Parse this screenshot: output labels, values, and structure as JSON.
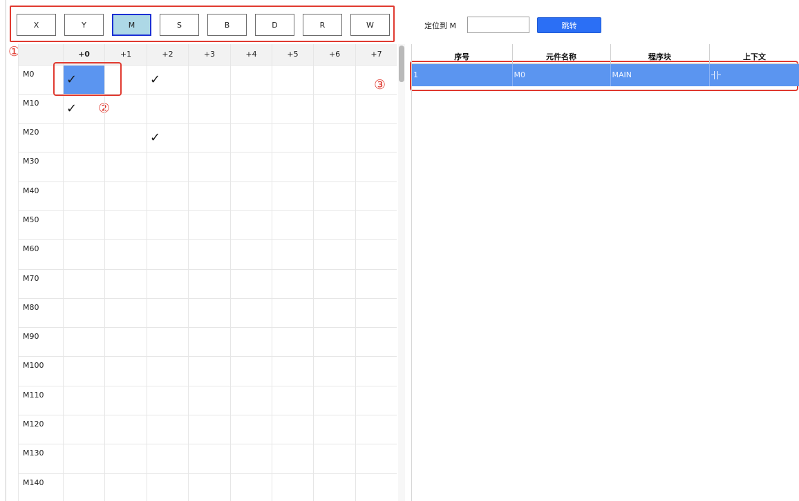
{
  "device_types": [
    {
      "label": "X",
      "active": false
    },
    {
      "label": "Y",
      "active": false
    },
    {
      "label": "M",
      "active": true
    },
    {
      "label": "S",
      "active": false
    },
    {
      "label": "B",
      "active": false
    },
    {
      "label": "D",
      "active": false
    },
    {
      "label": "R",
      "active": false
    },
    {
      "label": "W",
      "active": false
    }
  ],
  "locate": {
    "label": "定位到 M",
    "input_value": "",
    "button_label": "跳转"
  },
  "markers": [
    "①",
    "②",
    "③"
  ],
  "grid": {
    "columns": [
      "+0",
      "+1",
      "+2",
      "+3",
      "+4",
      "+5",
      "+6",
      "+7"
    ],
    "rows": [
      "M0",
      "M10",
      "M20",
      "M30",
      "M40",
      "M50",
      "M60",
      "M70",
      "M80",
      "M90",
      "M100",
      "M110",
      "M120",
      "M130",
      "M140"
    ],
    "check_glyph": "✓",
    "checked": [
      [
        0,
        0
      ],
      [
        0,
        2
      ],
      [
        1,
        0
      ],
      [
        2,
        2
      ]
    ],
    "selected": [
      0,
      0
    ]
  },
  "reference_table": {
    "headers": [
      "序号",
      "元件名称",
      "程序块",
      "上下文"
    ],
    "rows": [
      {
        "index": "1",
        "element": "M0",
        "block": "MAIN",
        "context": "contact-icon"
      }
    ]
  },
  "colors": {
    "accent_blue": "#2b6ff5",
    "selection_blue": "#5b95f0",
    "annotation_red": "#e0392f",
    "active_button_fill": "#add8e6"
  }
}
